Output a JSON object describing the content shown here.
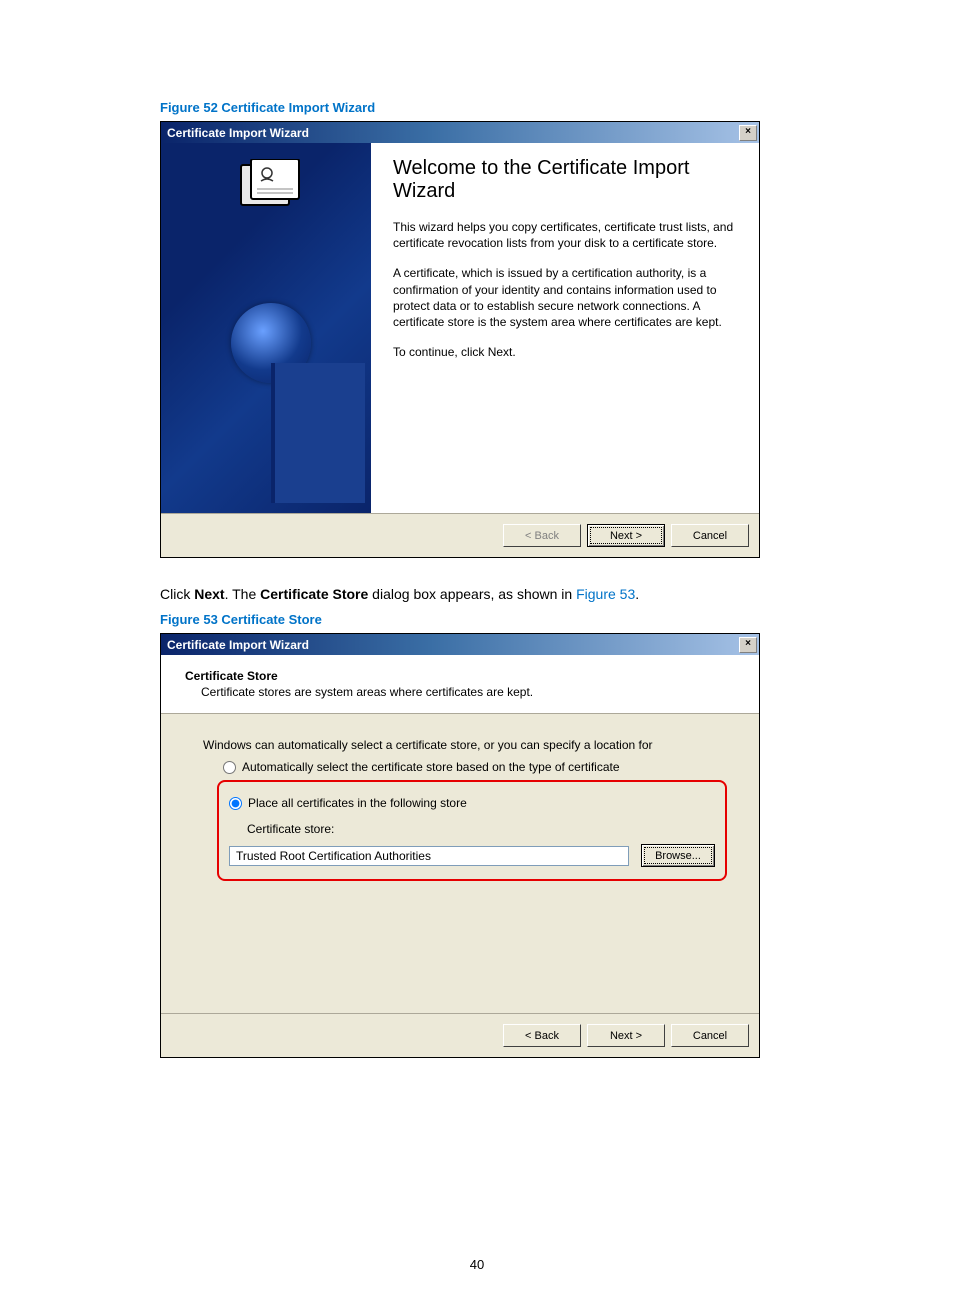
{
  "page_number": "40",
  "figure52": {
    "caption": "Figure 52 Certificate Import Wizard",
    "title": "Certificate Import Wizard",
    "heading": "Welcome to the Certificate Import Wizard",
    "para1": "This wizard helps you copy certificates, certificate trust lists, and certificate revocation lists from your disk to a certificate store.",
    "para2": "A certificate, which is issued by a certification authority, is a confirmation of your identity and contains information used to protect data or to establish secure network connections. A certificate store is the system area where certificates are kept.",
    "para3": "To continue, click Next.",
    "buttons": {
      "back": "< Back",
      "next": "Next >",
      "cancel": "Cancel"
    }
  },
  "between_text": {
    "pre": "Click ",
    "bold1": "Next",
    "mid1": ". The ",
    "bold2": "Certificate Store",
    "mid2": " dialog box appears, as shown in ",
    "link": "Figure 53",
    "post": "."
  },
  "figure53": {
    "caption": "Figure 53 Certificate Store",
    "title": "Certificate Import Wizard",
    "header_title": "Certificate Store",
    "header_sub": "Certificate stores are system areas where certificates are kept.",
    "body_intro": "Windows can automatically select a certificate store, or you can specify a location for",
    "radio_auto": "Automatically select the certificate store based on the type of certificate",
    "radio_place": "Place all certificates in the following store",
    "store_label": "Certificate store:",
    "store_value": "Trusted Root Certification Authorities",
    "browse": "Browse...",
    "buttons": {
      "back": "< Back",
      "next": "Next >",
      "cancel": "Cancel"
    }
  }
}
